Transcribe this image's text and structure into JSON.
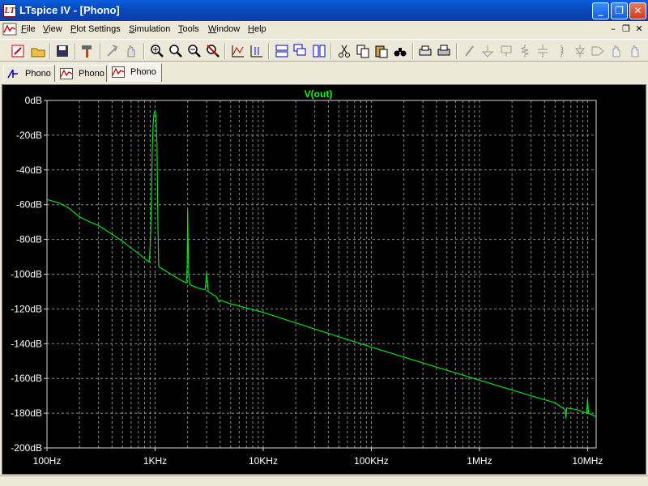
{
  "window": {
    "title": "LTspice IV - [Phono]",
    "app_icon": "ltspice-logo-icon"
  },
  "menu": {
    "items": [
      "File",
      "View",
      "Plot Settings",
      "Simulation",
      "Tools",
      "Window",
      "Help"
    ]
  },
  "tabs": [
    {
      "label": "Phono",
      "icon": "schematic-icon",
      "active": false
    },
    {
      "label": "Phono",
      "icon": "waveform-icon",
      "active": false
    },
    {
      "label": "Phono",
      "icon": "waveform-icon",
      "active": true
    }
  ],
  "colors": {
    "plot_background": "#000000",
    "trace": "#00e020",
    "grid": "#8c8c8c",
    "title_bar": "#0a4fc8"
  },
  "chart_data": {
    "type": "line",
    "title": "V(out)",
    "xlabel": "",
    "ylabel": "",
    "x_scale": "log",
    "xlim": [
      100,
      12000000
    ],
    "ylim": [
      -200,
      0
    ],
    "x_ticks": [
      {
        "value": 100,
        "label": "100Hz"
      },
      {
        "value": 1000,
        "label": "1KHz"
      },
      {
        "value": 10000,
        "label": "10KHz"
      },
      {
        "value": 100000,
        "label": "100KHz"
      },
      {
        "value": 1000000,
        "label": "1MHz"
      },
      {
        "value": 10000000,
        "label": "10MHz"
      }
    ],
    "y_ticks": [
      {
        "value": 0,
        "label": "0dB"
      },
      {
        "value": -20,
        "label": "-20dB"
      },
      {
        "value": -40,
        "label": "-40dB"
      },
      {
        "value": -60,
        "label": "-60dB"
      },
      {
        "value": -80,
        "label": "-80dB"
      },
      {
        "value": -100,
        "label": "-100dB"
      },
      {
        "value": -120,
        "label": "-120dB"
      },
      {
        "value": -140,
        "label": "-140dB"
      },
      {
        "value": -160,
        "label": "-160dB"
      },
      {
        "value": -180,
        "label": "-180dB"
      },
      {
        "value": -200,
        "label": "-200dB"
      }
    ],
    "grid": true,
    "series": [
      {
        "points": [
          [
            100,
            -57
          ],
          [
            130,
            -59
          ],
          [
            160,
            -62
          ],
          [
            200,
            -67
          ],
          [
            250,
            -70
          ],
          [
            300,
            -72
          ],
          [
            400,
            -77
          ],
          [
            500,
            -81
          ],
          [
            600,
            -85
          ],
          [
            700,
            -88
          ],
          [
            800,
            -91
          ],
          [
            880,
            -93
          ],
          [
            900,
            -85
          ],
          [
            920,
            -62
          ],
          [
            940,
            -30
          ],
          [
            960,
            -13
          ],
          [
            980,
            -7
          ],
          [
            1000,
            -6
          ],
          [
            1020,
            -9
          ],
          [
            1040,
            -25
          ],
          [
            1060,
            -70
          ],
          [
            1080,
            -95
          ],
          [
            1100,
            -96
          ],
          [
            1400,
            -100
          ],
          [
            1800,
            -104
          ],
          [
            1950,
            -105
          ],
          [
            1980,
            -95
          ],
          [
            2000,
            -63
          ],
          [
            2020,
            -80
          ],
          [
            2050,
            -100
          ],
          [
            2100,
            -106
          ],
          [
            2500,
            -108
          ],
          [
            2900,
            -109
          ],
          [
            2950,
            -104
          ],
          [
            3000,
            -99
          ],
          [
            3050,
            -104
          ],
          [
            3100,
            -110
          ],
          [
            3700,
            -113
          ],
          [
            3900,
            -116
          ],
          [
            4000,
            -115
          ],
          [
            5000,
            -117
          ],
          [
            10000,
            -122
          ],
          [
            100000,
            -142
          ],
          [
            1000000,
            -161
          ],
          [
            3000000,
            -170
          ],
          [
            5000000,
            -174
          ],
          [
            6200000,
            -178
          ],
          [
            6300000,
            -183
          ],
          [
            6400000,
            -177
          ],
          [
            8000000,
            -178
          ],
          [
            9800000,
            -180
          ],
          [
            10000000,
            -172
          ],
          [
            10200000,
            -180
          ],
          [
            12000000,
            -182
          ]
        ]
      }
    ]
  }
}
